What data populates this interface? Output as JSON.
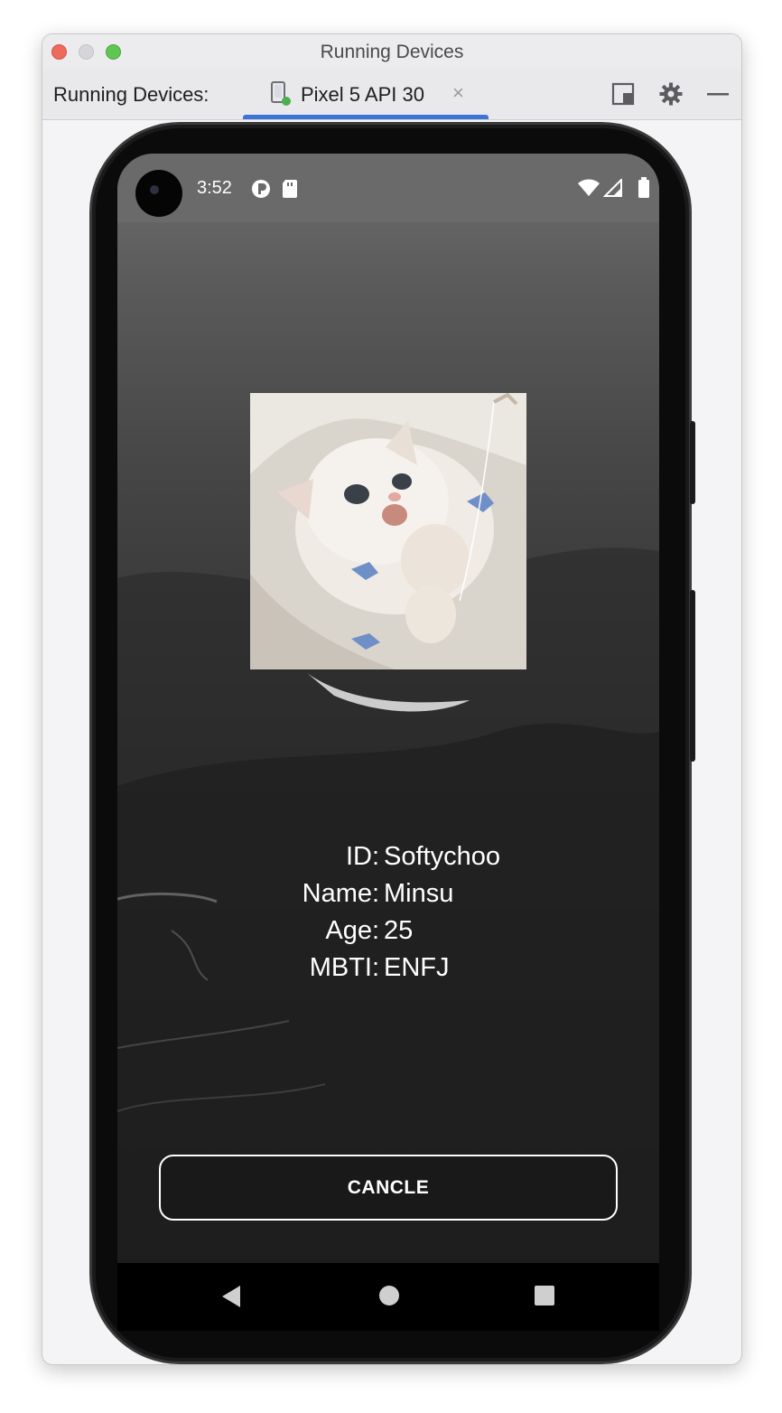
{
  "window": {
    "title": "Running Devices"
  },
  "toolbar": {
    "label": "Running Devices:",
    "tab": {
      "label": "Pixel 5 API 30",
      "close": "×"
    }
  },
  "statusbar": {
    "time": "3:52"
  },
  "profile": {
    "rows": [
      {
        "label": "ID",
        "colon": ":",
        "value": "Softychoo"
      },
      {
        "label": "Name",
        "colon": ":",
        "value": "Minsu"
      },
      {
        "label": "Age",
        "colon": ":",
        "value": "25"
      },
      {
        "label": "MBTI",
        "colon": ":",
        "value": "ENFJ"
      }
    ]
  },
  "buttons": {
    "cancel": "CANCLE"
  },
  "colors": {
    "accent": "#3b74d6",
    "close": "#ed6a5e",
    "maximize": "#61c554"
  }
}
